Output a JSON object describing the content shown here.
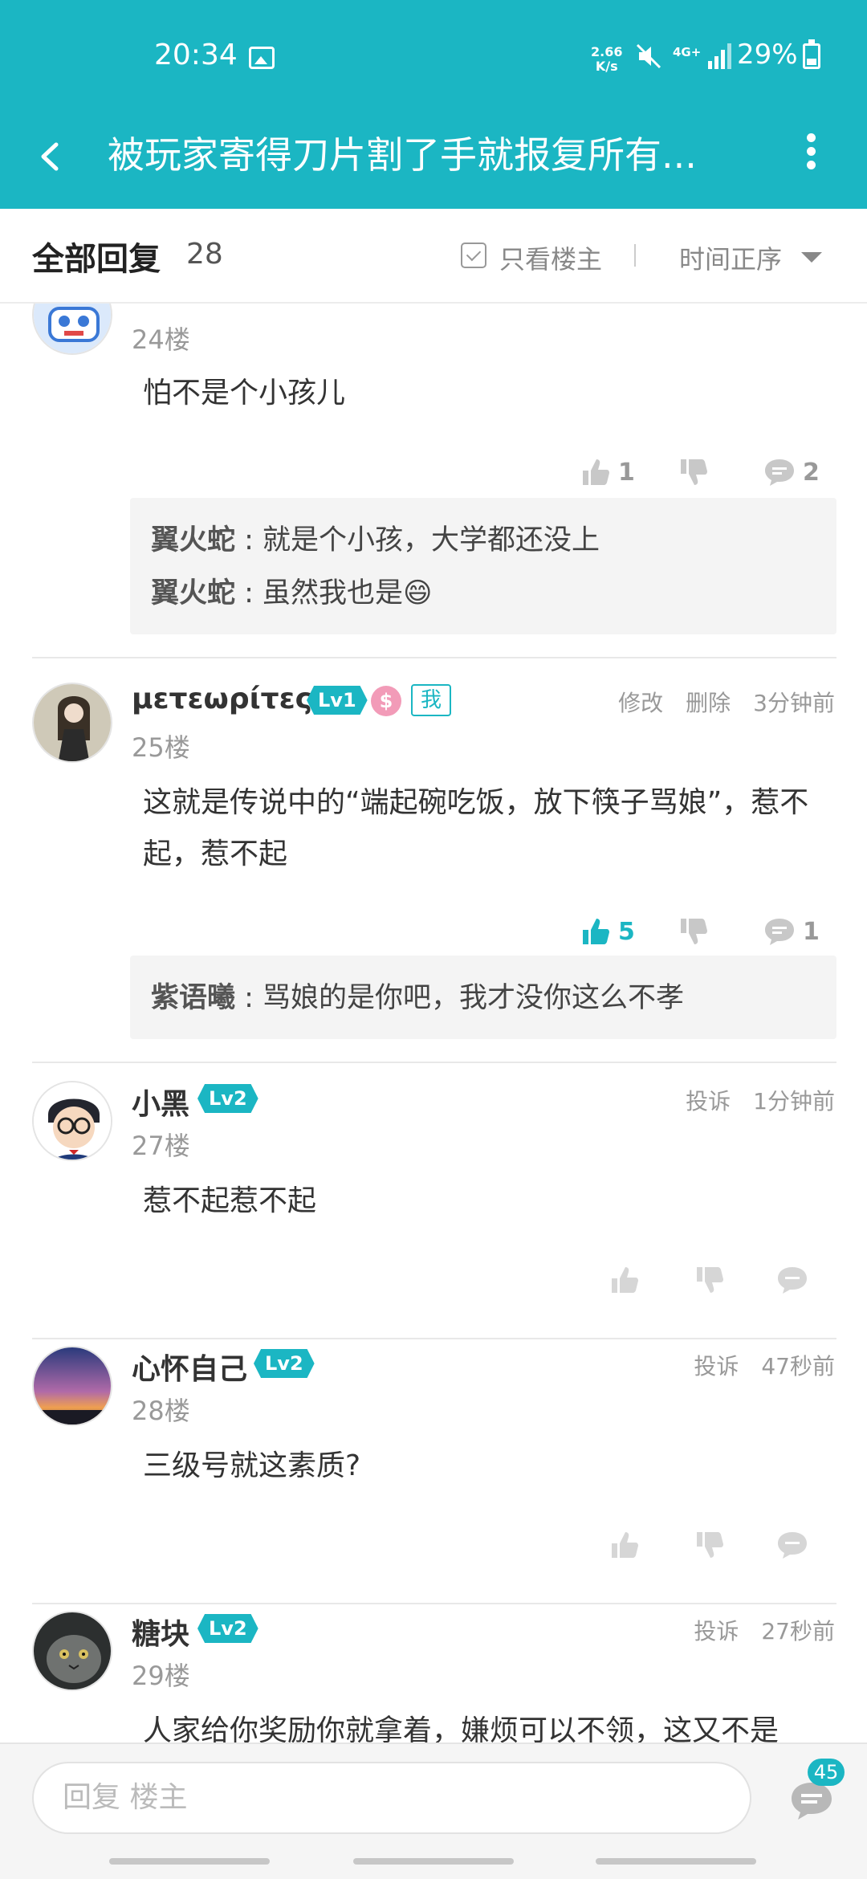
{
  "status": {
    "time": "20:34",
    "rate_top": "2.66",
    "rate_bottom": "K/s",
    "network": "4G+",
    "battery": "29%"
  },
  "header": {
    "title": "被玩家寄得刀片割了手就报复所有..."
  },
  "filter": {
    "title": "全部回复",
    "count": "28",
    "owner_only": "只看楼主",
    "order": "时间正序"
  },
  "posts": [
    {
      "name": "",
      "floor": "24楼",
      "meta": "",
      "content": "怕不是个小孩儿",
      "like": "1",
      "dislike": "",
      "comment": "2",
      "replies": [
        {
          "who": "翼火蛇",
          "text": " : 就是个小孩，大学都还没上"
        },
        {
          "who": "翼火蛇",
          "text": " : 虽然我也是😄"
        }
      ]
    },
    {
      "name": "μετεωρίτες",
      "level": "Lv1",
      "me": "我",
      "floor": "25楼",
      "meta": "修改　删除　3分钟前",
      "content": "这就是传说中的“端起碗吃饭，放下筷子骂娘”，惹不起，惹不起",
      "like": "5",
      "comment": "1",
      "replies": [
        {
          "who": "紫语曦",
          "text": " : 骂娘的是你吧，我才没你这么不孝"
        }
      ]
    },
    {
      "name": "小黑",
      "level": "Lv2",
      "floor": "27楼",
      "meta": "投诉　1分钟前",
      "content": "惹不起惹不起"
    },
    {
      "name": "心怀自己",
      "level": "Lv2",
      "floor": "28楼",
      "meta": "投诉　47秒前",
      "content": "三级号就这素质?"
    },
    {
      "name": "糖块",
      "level": "Lv2",
      "floor": "29楼",
      "meta": "投诉　27秒前",
      "content": "人家给你奖励你就拿着，嫌烦可以不领，这又不是"
    }
  ],
  "reply_bar": {
    "placeholder": "回复  楼主",
    "badge": "45"
  },
  "colors": {
    "accent": "#1bb6c3"
  }
}
